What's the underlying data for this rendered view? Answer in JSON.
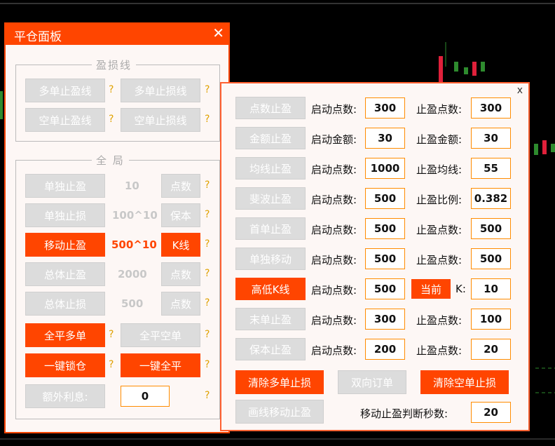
{
  "panel_left": {
    "title": "平仓面板",
    "close_icon": "✕",
    "group_profit_loss": {
      "title": "盈损线",
      "buttons": [
        "多单止盈线",
        "多单止损线",
        "空单止盈线",
        "空单止损线"
      ]
    },
    "group_global": {
      "title": "全 局",
      "rows": [
        {
          "button": "单独止盈",
          "value": "10",
          "side": "点数",
          "active": false
        },
        {
          "button": "单独止损",
          "value": "100^10",
          "side": "保本",
          "active": false
        },
        {
          "button": "移动止盈",
          "value": "500^10",
          "side": "K线",
          "active": true
        },
        {
          "button": "总体止盈",
          "value": "2000",
          "side": "点数",
          "active": false
        },
        {
          "button": "总体止损",
          "value": "500",
          "side": "点数",
          "active": false
        }
      ],
      "close_buy": "全平多单",
      "close_sell": "全平空单",
      "lock": "一键锁仓",
      "close_all": "一键全平",
      "extra_interest_label": "额外利息:",
      "extra_interest_value": "0"
    },
    "help": "?"
  },
  "panel_right": {
    "close_icon": "x",
    "rows": [
      {
        "button": "点数止盈",
        "l1": "启动点数:",
        "v1": "300",
        "l2": "止盈点数:",
        "v2": "300",
        "active": false
      },
      {
        "button": "金额止盈",
        "l1": "启动金额:",
        "v1": "30",
        "l2": "止盈金额:",
        "v2": "30",
        "active": false
      },
      {
        "button": "均线止盈",
        "l1": "启动点数:",
        "v1": "1000",
        "l2": "止盈均线:",
        "v2": "55",
        "active": false
      },
      {
        "button": "斐波止盈",
        "l1": "启动点数:",
        "v1": "500",
        "l2": "止盈比例:",
        "v2": "0.382",
        "active": false
      },
      {
        "button": "首单止盈",
        "l1": "启动点数:",
        "v1": "500",
        "l2": "止盈点数:",
        "v2": "500",
        "active": false
      },
      {
        "button": "单独移动",
        "l1": "启动点数:",
        "v1": "500",
        "l2": "止盈点数:",
        "v2": "500",
        "active": false
      },
      {
        "button": "高低K线",
        "l1": "启动点数:",
        "v1": "500",
        "l2": "K:",
        "v2": "10",
        "active": true,
        "extra_button": "当前"
      },
      {
        "button": "末单止盈",
        "l1": "启动点数:",
        "v1": "300",
        "l2": "止盈点数:",
        "v2": "100",
        "active": false
      },
      {
        "button": "保本止盈",
        "l1": "启动点数:",
        "v1": "200",
        "l2": "止盈点数:",
        "v2": "20",
        "active": false
      }
    ],
    "clear_buy_sl": "清除多单止损",
    "two_way_order": "双向订单",
    "clear_sell_sl": "清除空单止损",
    "line_trailing": "画线移动止盈",
    "trailing_seconds_label": "移动止盈判断秒数:",
    "trailing_seconds_value": "20"
  },
  "colors": {
    "accent": "#ff4500",
    "disabled": "#dcdcdc",
    "help": "#e0a200"
  }
}
